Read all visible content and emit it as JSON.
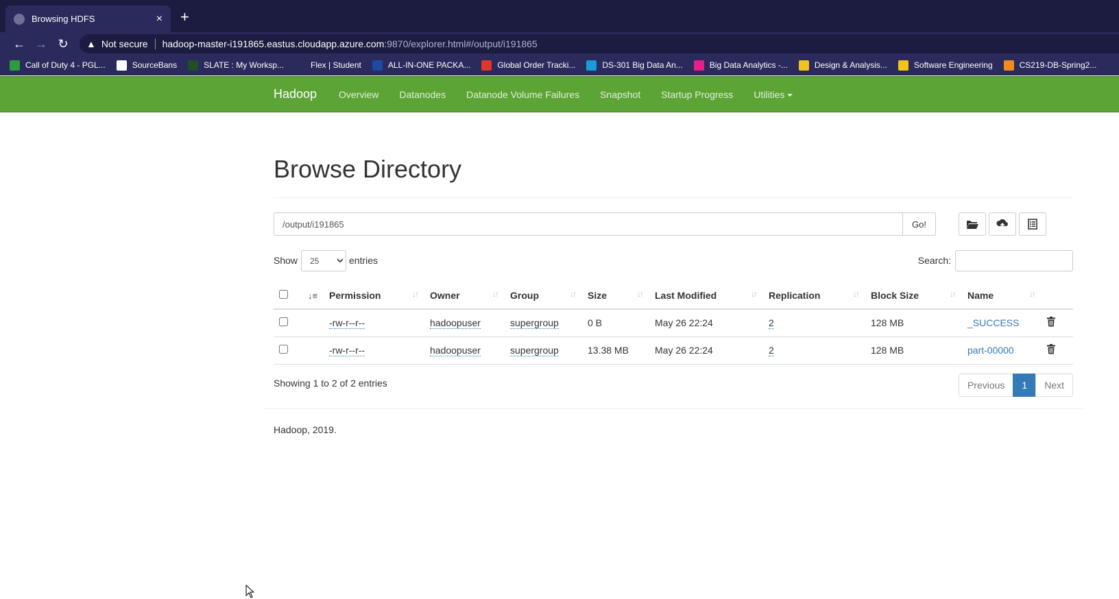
{
  "browser": {
    "tab_title": "Browsing HDFS",
    "tab_close": "×",
    "new_tab": "+",
    "security_label": "Not secure",
    "url_host": "hadoop-master-i191865.eastus.cloudapp.azure.com",
    "url_path": ":9870/explorer.html#/output/i191865",
    "bookmarks": [
      {
        "label": "Call of Duty 4 - PGL...",
        "color": "#2e9b3e"
      },
      {
        "label": "SourceBans",
        "color": "#ffffff"
      },
      {
        "label": "SLATE : My Worksp...",
        "color": "#1f4f2a"
      },
      {
        "label": "Flex | Student",
        "color": "#2a2b5c"
      },
      {
        "label": "ALL-IN-ONE PACKA...",
        "color": "#1d4aa3"
      },
      {
        "label": "Global Order Tracki...",
        "color": "#e0372c"
      },
      {
        "label": "DS-301 Big Data An...",
        "color": "#1a9bd7"
      },
      {
        "label": "Big Data Analytics -...",
        "color": "#e91e8c"
      },
      {
        "label": "Design & Analysis...",
        "color": "#f0c419"
      },
      {
        "label": "Software Engineering",
        "color": "#f0c419"
      },
      {
        "label": "CS219-DB-Spring2...",
        "color": "#f28b1d"
      }
    ]
  },
  "navbar": {
    "brand": "Hadoop",
    "links": [
      "Overview",
      "Datanodes",
      "Datanode Volume Failures",
      "Snapshot",
      "Startup Progress",
      "Utilities"
    ]
  },
  "page": {
    "title": "Browse Directory",
    "path_value": "/output/i191865",
    "go_label": "Go!",
    "show_label": "Show",
    "entries_value": "25",
    "entries_label": "entries",
    "search_label": "Search:",
    "columns": [
      "Permission",
      "Owner",
      "Group",
      "Size",
      "Last Modified",
      "Replication",
      "Block Size",
      "Name"
    ],
    "rows": [
      {
        "permission": "-rw-r--r--",
        "owner": "hadoopuser",
        "group": "supergroup",
        "size": "0 B",
        "modified": "May 26 22:24",
        "replication": "2",
        "block_size": "128 MB",
        "name": "_SUCCESS"
      },
      {
        "permission": "-rw-r--r--",
        "owner": "hadoopuser",
        "group": "supergroup",
        "size": "13.38 MB",
        "modified": "May 26 22:24",
        "replication": "2",
        "block_size": "128 MB",
        "name": "part-00000"
      }
    ],
    "showing": "Showing 1 to 2 of 2 entries",
    "pager": {
      "previous": "Previous",
      "current": "1",
      "next": "Next"
    },
    "footer": "Hadoop, 2019."
  },
  "colors": {
    "navbar": "#5ca436",
    "link": "#337ab7",
    "chrome": "#1b1c40"
  }
}
